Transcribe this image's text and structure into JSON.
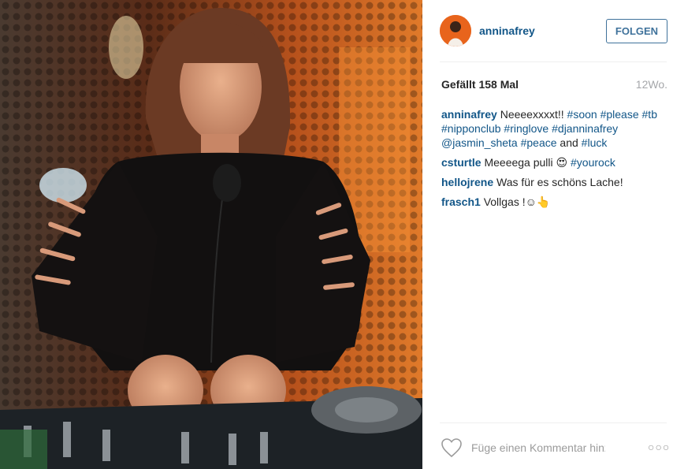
{
  "post": {
    "username": "anninafrey",
    "follow_label": "FOLGEN",
    "likes": "Gefällt 158 Mal",
    "age": "12Wo."
  },
  "caption": {
    "user": "anninafrey",
    "parts": [
      {
        "type": "text",
        "value": "Neeeexxxxt!! "
      },
      {
        "type": "tag",
        "value": "#soon"
      },
      {
        "type": "text",
        "value": " "
      },
      {
        "type": "tag",
        "value": "#please"
      },
      {
        "type": "text",
        "value": " "
      },
      {
        "type": "tag",
        "value": "#tb"
      },
      {
        "type": "text",
        "value": " "
      },
      {
        "type": "tag",
        "value": "#nipponclub"
      },
      {
        "type": "text",
        "value": " "
      },
      {
        "type": "tag",
        "value": "#ringlove"
      },
      {
        "type": "text",
        "value": " "
      },
      {
        "type": "tag",
        "value": "#djanninafrey"
      },
      {
        "type": "text",
        "value": " "
      },
      {
        "type": "tag",
        "value": "@jasmin_sheta"
      },
      {
        "type": "text",
        "value": " "
      },
      {
        "type": "tag",
        "value": "#peace"
      },
      {
        "type": "text",
        "value": " and "
      },
      {
        "type": "tag",
        "value": "#luck"
      }
    ]
  },
  "comments": [
    {
      "user": "csturtle",
      "parts": [
        {
          "type": "text",
          "value": "Meeeega pulli 😍 "
        },
        {
          "type": "tag",
          "value": "#yourock"
        }
      ]
    },
    {
      "user": "hellojrene",
      "parts": [
        {
          "type": "text",
          "value": "Was für es schöns Lache!"
        }
      ]
    },
    {
      "user": "frasch1",
      "parts": [
        {
          "type": "text",
          "value": "Vollgas !☺👆"
        }
      ]
    }
  ],
  "footer": {
    "comment_placeholder": "Füge einen Kommentar hinzu …",
    "more_label": "○○○"
  },
  "colors": {
    "link": "#125688",
    "follow": "#3f729b",
    "muted": "#a5a7aa"
  },
  "icons": {
    "like": "heart-outline-icon",
    "more": "more-options-icon"
  }
}
